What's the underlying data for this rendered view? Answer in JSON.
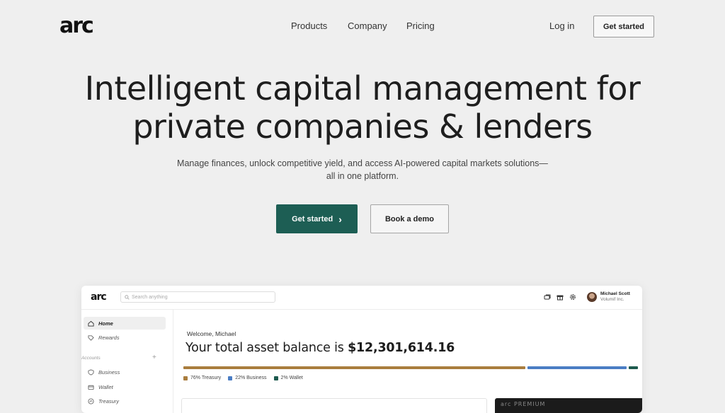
{
  "brand": {
    "logo": "arc"
  },
  "nav": {
    "products": "Products",
    "company": "Company",
    "pricing": "Pricing",
    "login": "Log in",
    "cta": "Get started"
  },
  "hero": {
    "title_line1": "Intelligent capital management for",
    "title_line2": "private companies & lenders",
    "subtitle_line1": "Manage finances, unlock competitive yield, and access AI-powered capital markets solutions—",
    "subtitle_line2": "all in one platform.",
    "primary_cta": "Get started",
    "secondary_cta": "Book a demo"
  },
  "preview": {
    "logo": "arc",
    "search_placeholder": "Search anything",
    "user": {
      "name": "Michael Scott",
      "org": "Volumif Inc."
    },
    "sidebar": {
      "home": "Home",
      "rewards": "Rewards",
      "accounts_heading": "Accounts",
      "business": "Business",
      "wallet": "Wallet",
      "treasury": "Treasury"
    },
    "welcome": "Welcome, Michael",
    "balance_prefix": "Your total asset balance is ",
    "balance_value": "$12,301,614.16",
    "allocation": [
      {
        "label": "76% Treasury",
        "fraction": 0.76,
        "color": "#a97d3e"
      },
      {
        "label": "22% Business",
        "fraction": 0.22,
        "color": "#4a7dc4"
      },
      {
        "label": "2% Wallet",
        "fraction": 0.02,
        "color": "#1d5a4e"
      }
    ],
    "dark_card_label": "arc PREMIUM"
  },
  "colors": {
    "accent": "#1d5e54",
    "background": "#efefef"
  }
}
